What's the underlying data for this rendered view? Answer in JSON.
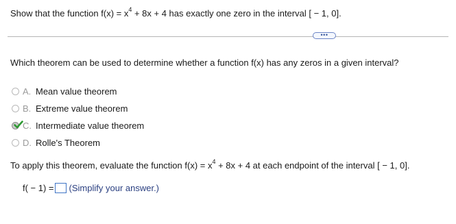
{
  "problem": {
    "prefix": "Show that the function f(x) = x",
    "exponent": "4",
    "suffix": " + 8x + 4 has exactly one zero in the interval [ − 1, 0]."
  },
  "more_button": {
    "label": "•••"
  },
  "question": {
    "text": "Which theorem can be used to determine whether a function f(x) has any zeros in a given interval?"
  },
  "options": [
    {
      "letter": "A.",
      "text": "Mean value theorem",
      "selected": false
    },
    {
      "letter": "B.",
      "text": "Extreme value theorem",
      "selected": false
    },
    {
      "letter": "C.",
      "text": "Intermediate value theorem",
      "selected": true
    },
    {
      "letter": "D.",
      "text": "Rolle's Theorem",
      "selected": false
    }
  ],
  "apply": {
    "prefix": "To apply this theorem, evaluate the function f(x) = x",
    "exponent": "4",
    "suffix": " + 8x + 4 at each endpoint of the interval [ − 1, 0]."
  },
  "answer": {
    "label": "f( − 1) =",
    "value": "",
    "hint": "(Simplify your answer.)"
  },
  "colors": {
    "check_mark": "#2e9a33",
    "input_border": "#3f74c6",
    "option_letter": "#9a9a9a",
    "hint_text": "#2a3f80"
  }
}
